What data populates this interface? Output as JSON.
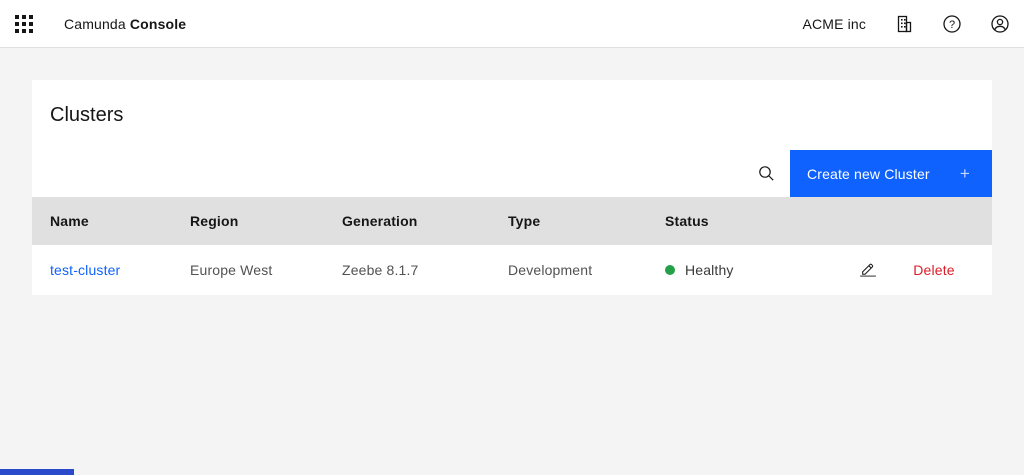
{
  "header": {
    "brand": {
      "name": "Camunda",
      "product": "Console"
    },
    "org_name": "ACME inc"
  },
  "icons": {
    "switcher": "app-switcher-icon",
    "organization": "building-icon",
    "help": "help-icon",
    "help_glyph": "?",
    "user": "user-avatar-icon",
    "search": "search-icon",
    "edit": "edit-pencil-icon",
    "status_dot": "healthy-status-dot"
  },
  "main": {
    "title": "Clusters",
    "create_button": {
      "label": "Create new Cluster",
      "plus_icon": "+"
    },
    "table": {
      "columns": [
        "Name",
        "Region",
        "Generation",
        "Type",
        "Status"
      ],
      "rows": [
        {
          "name": "test-cluster",
          "region": "Europe West",
          "generation": "Zeebe 8.1.7",
          "type": "Development",
          "status": "Healthy",
          "delete_label": "Delete"
        }
      ]
    }
  },
  "colors": {
    "accent_blue": "#0f62fe",
    "link_blue": "#0f62fe",
    "delete_red": "#da1e28",
    "healthy_green": "#24a148",
    "table_header_gray": "#e0e0e0",
    "page_background": "#f4f4f4",
    "partial_bottom_blue": "#2b4acb"
  }
}
